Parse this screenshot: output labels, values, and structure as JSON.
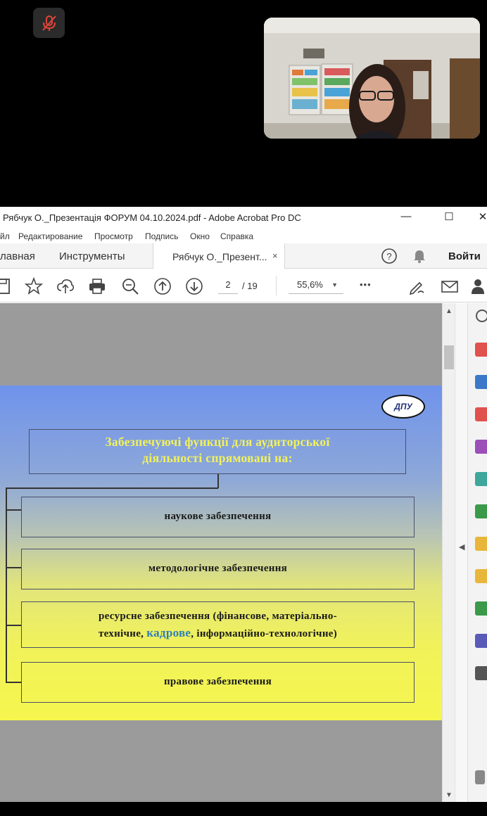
{
  "call": {
    "mic_state": "muted"
  },
  "window": {
    "title": "Рябчук О._Презентація ФОРУМ 04.10.2024.pdf - Adobe Acrobat Pro DC",
    "minimize": "—",
    "maximize": "☐",
    "close": "✕"
  },
  "menu": {
    "items": [
      "йл",
      "Редактирование",
      "Просмотр",
      "Подпись",
      "Окно",
      "Справка"
    ]
  },
  "tabs": {
    "home": "лавная",
    "tools": "Инструменты",
    "doc": "Рябчук О._Презент...",
    "doc_close": "×",
    "help": "?",
    "signin": "Войти"
  },
  "toolbar": {
    "page_current": "2",
    "page_total": "/ 19",
    "zoom": "55,6%",
    "more": "•••"
  },
  "slide": {
    "logo": "ДПУ",
    "heading_line1": "Забезпечуючі функції для аудиторської",
    "heading_line2": "діяльності спрямовані на:",
    "item1": "наукове забезпечення",
    "item2": "методологічне забезпечення",
    "item3_a": "ресурсне забезпечення (фінансове, матеріально-",
    "item3_b": "технічне, ",
    "item3_highlight": "кадрове",
    "item3_c": ", інформаційно-технологічне)",
    "item4": "правове забезпечення"
  },
  "colors": {
    "heading": "#f2f25a",
    "highlight": "#2f7fb8",
    "slide_top": "#6f93ec",
    "slide_bottom": "#f5f64e"
  },
  "right_panel_icons": [
    "comment-tool-icon",
    "export-pdf-icon",
    "create-pdf-icon",
    "organize-pages-icon",
    "fill-sign-icon",
    "edit-pdf-icon",
    "compare-icon",
    "export-icon",
    "comment-icon",
    "print-production-icon",
    "protect-icon",
    "more-tools-icon",
    "measure-icon"
  ]
}
